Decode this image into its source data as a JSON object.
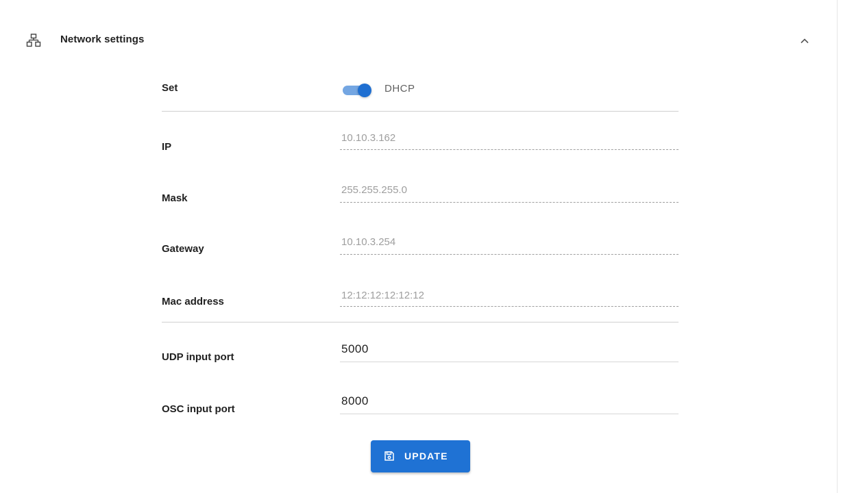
{
  "section": {
    "title": "Network settings",
    "icon": "network-icon",
    "collapse_icon": "chevron-up-icon"
  },
  "fields": {
    "set": {
      "label": "Set",
      "toggle_label": "DHCP",
      "toggle_on": true
    },
    "ip": {
      "label": "IP",
      "value": "10.10.3.162"
    },
    "mask": {
      "label": "Mask",
      "value": "255.255.255.0"
    },
    "gateway": {
      "label": "Gateway",
      "value": "10.10.3.254"
    },
    "mac": {
      "label": "Mac address",
      "value": "12:12:12:12:12:12"
    },
    "udp": {
      "label": "UDP input port",
      "value": "5000"
    },
    "osc": {
      "label": "OSC input port",
      "value": "8000"
    }
  },
  "actions": {
    "update_label": "UPDATE",
    "update_icon": "save-icon"
  },
  "colors": {
    "accent": "#1f72d4",
    "toggle_track": "#74a6e2",
    "readonly_text": "#9e9e9e"
  }
}
